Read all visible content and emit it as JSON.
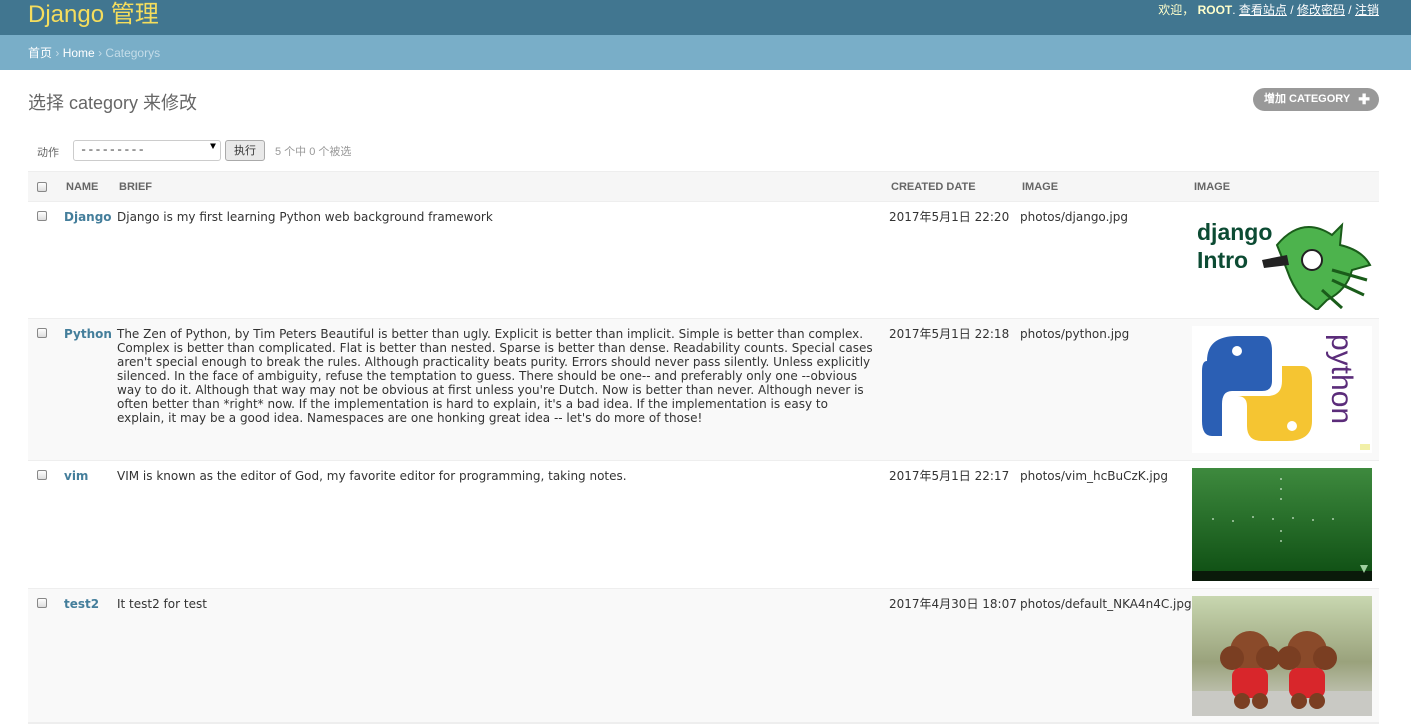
{
  "header": {
    "brand": "Django 管理",
    "welcome": "欢迎，",
    "username": "ROOT",
    "links": [
      "查看站点",
      "修改密码",
      "注销"
    ]
  },
  "breadcrumbs": {
    "items": [
      "首页",
      "Home",
      "Categorys"
    ]
  },
  "page": {
    "title": "选择 category 来修改",
    "add_label": "增加 CATEGORY"
  },
  "actions": {
    "label": "动作",
    "select_value": "---------",
    "run_label": "执行",
    "counter": "5 个中 0 个被选"
  },
  "table": {
    "headers": [
      "NAME",
      "BRIEF",
      "CREATED DATE",
      "IMAGE",
      "IMAGE"
    ],
    "rows": [
      {
        "name": "Django",
        "brief": "Django is my first learning Python web background framework",
        "created": "2017年5月1日 22:20",
        "image_path": "photos/django.jpg",
        "thumb_text": [
          "django",
          "Intro"
        ]
      },
      {
        "name": "Python",
        "brief": "The Zen of Python, by Tim Peters Beautiful is better than ugly. Explicit is better than implicit. Simple is better than complex. Complex is better than complicated. Flat is better than nested. Sparse is better than dense. Readability counts. Special cases aren't special enough to break the rules. Although practicality beats purity. Errors should never pass silently. Unless explicitly silenced. In the face of ambiguity, refuse the temptation to guess. There should be one-- and preferably only one --obvious way to do it. Although that way may not be obvious at first unless you're Dutch. Now is better than never. Although never is often better than *right* now. If the implementation is hard to explain, it's a bad idea. If the implementation is easy to explain, it may be a good idea. Namespaces are one honking great idea -- let's do more of those!",
        "created": "2017年5月1日 22:18",
        "image_path": "photos/python.jpg",
        "thumb_text": [
          "python"
        ]
      },
      {
        "name": "vim",
        "brief": "VIM is known as the editor of God, my favorite editor for programming, taking notes.",
        "created": "2017年5月1日 22:17",
        "image_path": "photos/vim_hcBuCzK.jpg",
        "thumb_text": []
      },
      {
        "name": "test2",
        "brief": "It test2 for test",
        "created": "2017年4月30日 18:07",
        "image_path": "photos/default_NKA4n4C.jpg",
        "thumb_text": []
      }
    ]
  },
  "colors": {
    "header_bg": "#417690",
    "breadcrumb_bg": "#79aec8",
    "brand": "#f5dd5d",
    "link": "#447e9b"
  }
}
